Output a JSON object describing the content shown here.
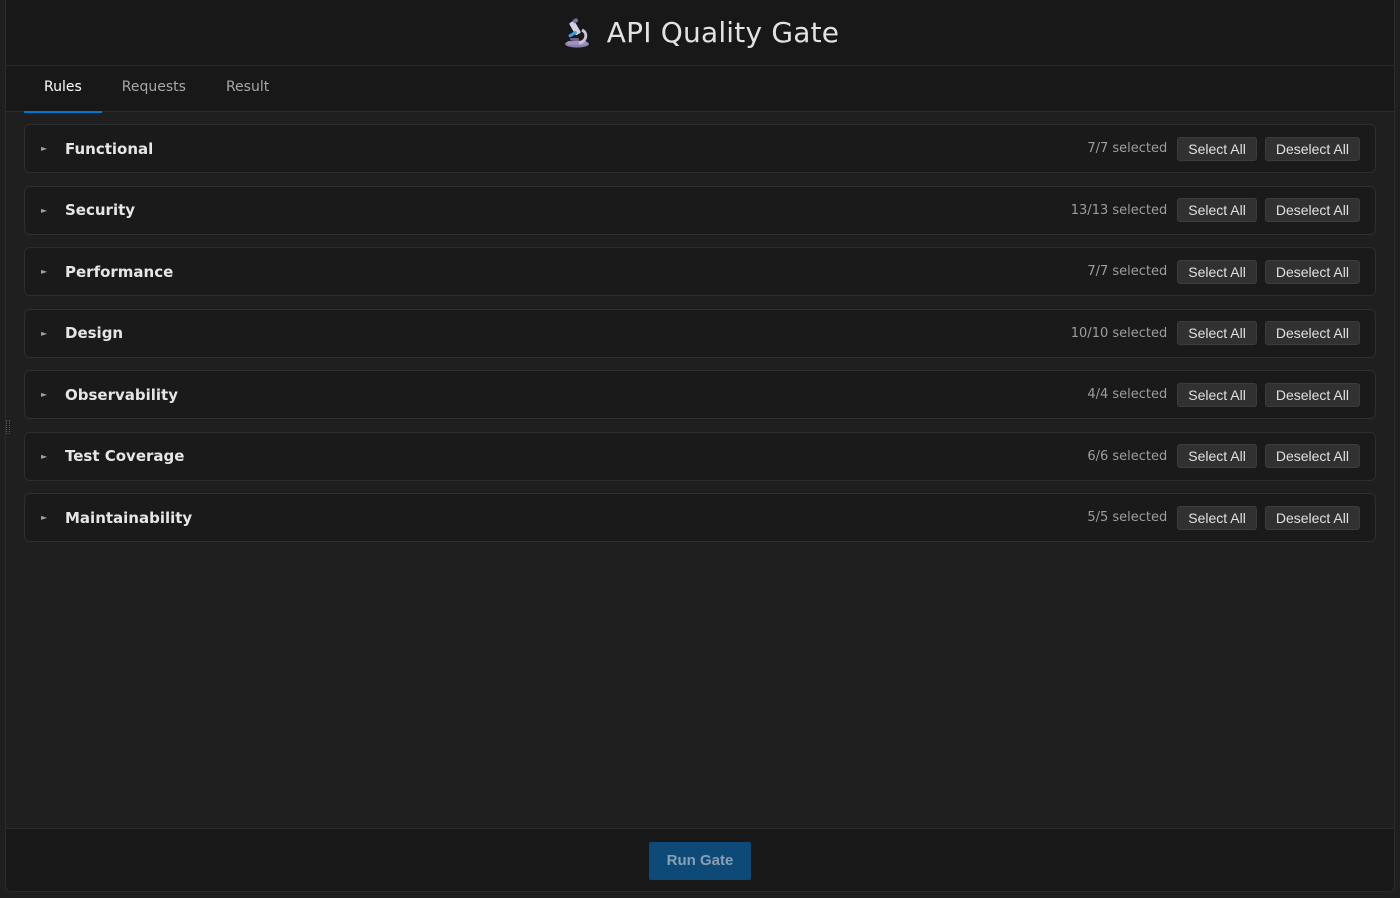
{
  "header": {
    "title": "API Quality Gate",
    "icon": "microscope-icon"
  },
  "tabs": [
    {
      "label": "Rules",
      "active": true
    },
    {
      "label": "Requests",
      "active": false
    },
    {
      "label": "Result",
      "active": false
    }
  ],
  "categories": [
    {
      "name": "Functional",
      "count": "7/7 selected",
      "select_all": "Select All",
      "deselect_all": "Deselect All"
    },
    {
      "name": "Security",
      "count": "13/13 selected",
      "select_all": "Select All",
      "deselect_all": "Deselect All"
    },
    {
      "name": "Performance",
      "count": "7/7 selected",
      "select_all": "Select All",
      "deselect_all": "Deselect All"
    },
    {
      "name": "Design",
      "count": "10/10 selected",
      "select_all": "Select All",
      "deselect_all": "Deselect All"
    },
    {
      "name": "Observability",
      "count": "4/4 selected",
      "select_all": "Select All",
      "deselect_all": "Deselect All"
    },
    {
      "name": "Test Coverage",
      "count": "6/6 selected",
      "select_all": "Select All",
      "deselect_all": "Deselect All"
    },
    {
      "name": "Maintainability",
      "count": "5/5 selected",
      "select_all": "Select All",
      "deselect_all": "Deselect All"
    }
  ],
  "footer": {
    "run_label": "Run Gate"
  },
  "colors": {
    "accent": "#0078d4",
    "run_button": "#0e4a78",
    "background": "#1f1f1f"
  }
}
